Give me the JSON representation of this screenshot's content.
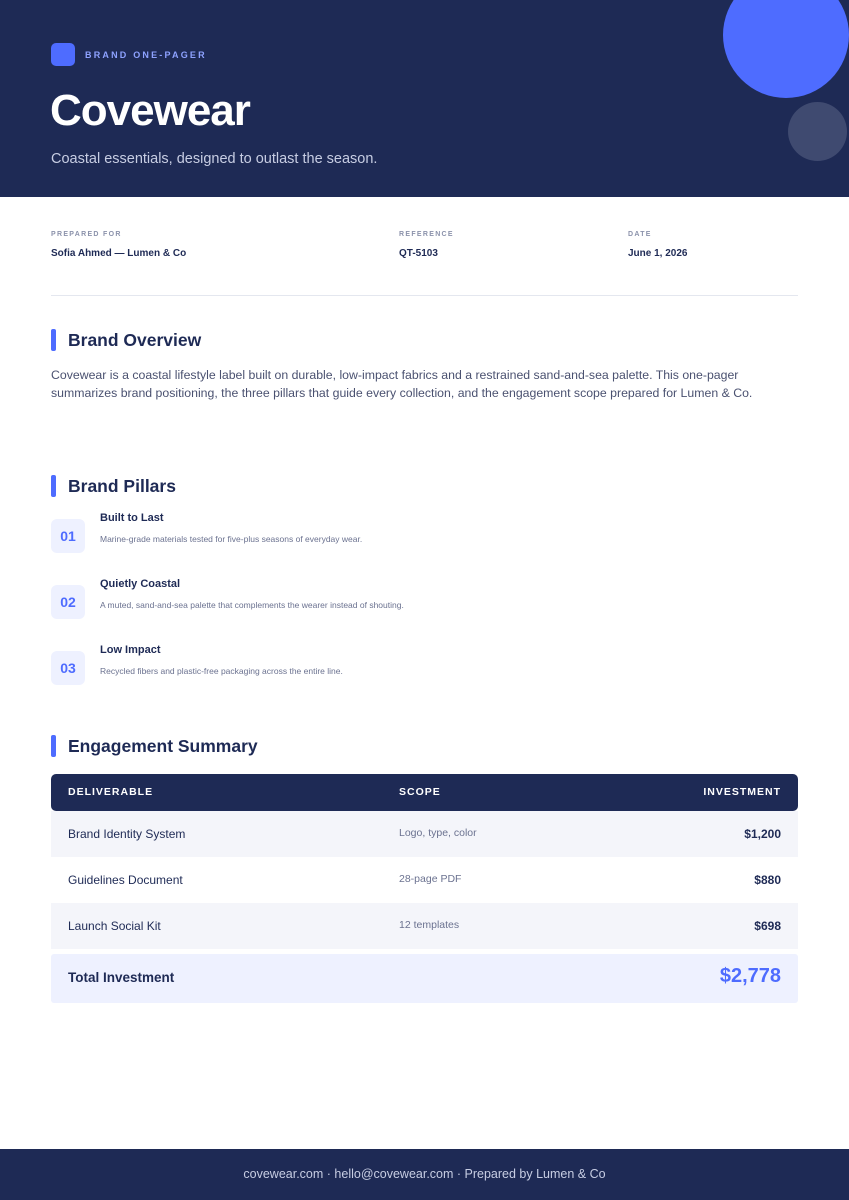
{
  "header": {
    "eyebrow": "BRAND ONE-PAGER",
    "title": "Covewear",
    "tagline": "Coastal essentials, designed to outlast the season."
  },
  "meta": {
    "prepared_for": {
      "label": "PREPARED FOR",
      "value": "Sofia Ahmed — Lumen & Co"
    },
    "reference": {
      "label": "REFERENCE",
      "value": "QT-5103"
    },
    "date": {
      "label": "DATE",
      "value": "June 1, 2026"
    }
  },
  "overview": {
    "heading": "Brand Overview",
    "body": "Covewear is a coastal lifestyle label built on durable, low-impact fabrics and a restrained sand-and-sea palette. This one-pager summarizes brand positioning, the three pillars that guide every collection, and the engagement scope prepared for Lumen & Co."
  },
  "pillars": {
    "heading": "Brand Pillars",
    "items": [
      {
        "num": "01",
        "title": "Built to Last",
        "desc": "Marine-grade materials tested for five-plus seasons of everyday wear."
      },
      {
        "num": "02",
        "title": "Quietly Coastal",
        "desc": "A muted, sand-and-sea palette that complements the wearer instead of shouting."
      },
      {
        "num": "03",
        "title": "Low Impact",
        "desc": "Recycled fibers and plastic-free packaging across the entire line."
      }
    ]
  },
  "engagement": {
    "heading": "Engagement Summary",
    "columns": [
      "DELIVERABLE",
      "SCOPE",
      "INVESTMENT"
    ],
    "rows": [
      {
        "deliverable": "Brand Identity System",
        "scope": "Logo, type, color",
        "investment": "$1,200"
      },
      {
        "deliverable": "Guidelines Document",
        "scope": "28-page PDF",
        "investment": "$880"
      },
      {
        "deliverable": "Launch Social Kit",
        "scope": "12 templates",
        "investment": "$698"
      }
    ],
    "total_label": "Total Investment",
    "total_value": "$2,778"
  },
  "footer": {
    "text": "covewear.com · hello@covewear.com · Prepared by Lumen & Co"
  },
  "colors": {
    "navy": "#1e2a55",
    "accent": "#4e6cff",
    "tint": "#eef1ff"
  }
}
